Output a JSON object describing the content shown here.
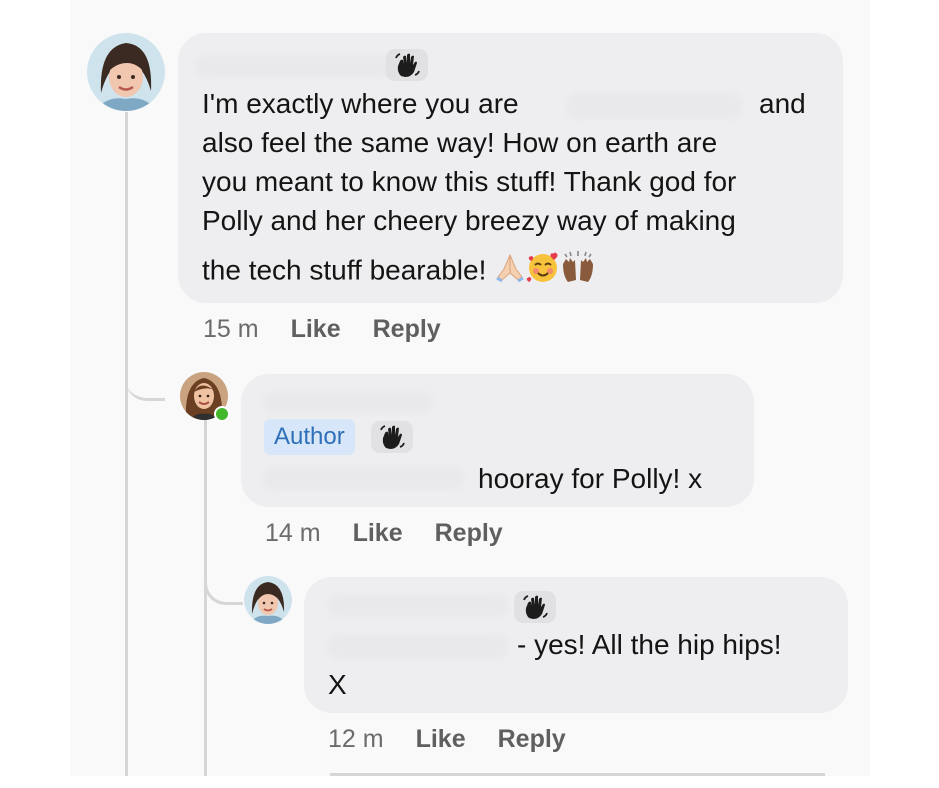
{
  "comments": [
    {
      "lines": [
        "I'm exactly where you are",
        "and",
        "also feel the same way! How on earth are",
        "you meant to know this stuff! Thank god for",
        "Polly and her cheery breezy way of making",
        "the tech stuff bearable!"
      ],
      "emojis": [
        "folded-hands-icon",
        "smiling-face-with-hearts-icon",
        "raising-hands-icon"
      ],
      "time": "15 m",
      "like": "Like",
      "reply": "Reply"
    },
    {
      "badge": "Author",
      "lines": [
        "hooray for Polly! x"
      ],
      "time": "14 m",
      "like": "Like",
      "reply": "Reply",
      "online": true
    },
    {
      "lines": [
        "- yes! All the hip hips!",
        "X"
      ],
      "time": "12 m",
      "like": "Like",
      "reply": "Reply"
    }
  ],
  "colors": {
    "bubble": "#eeeef0",
    "author_badge_bg": "#d7e6f8",
    "author_badge_text": "#2e6fb9",
    "online": "#42b72a",
    "thread_line": "#d6d6d8"
  }
}
